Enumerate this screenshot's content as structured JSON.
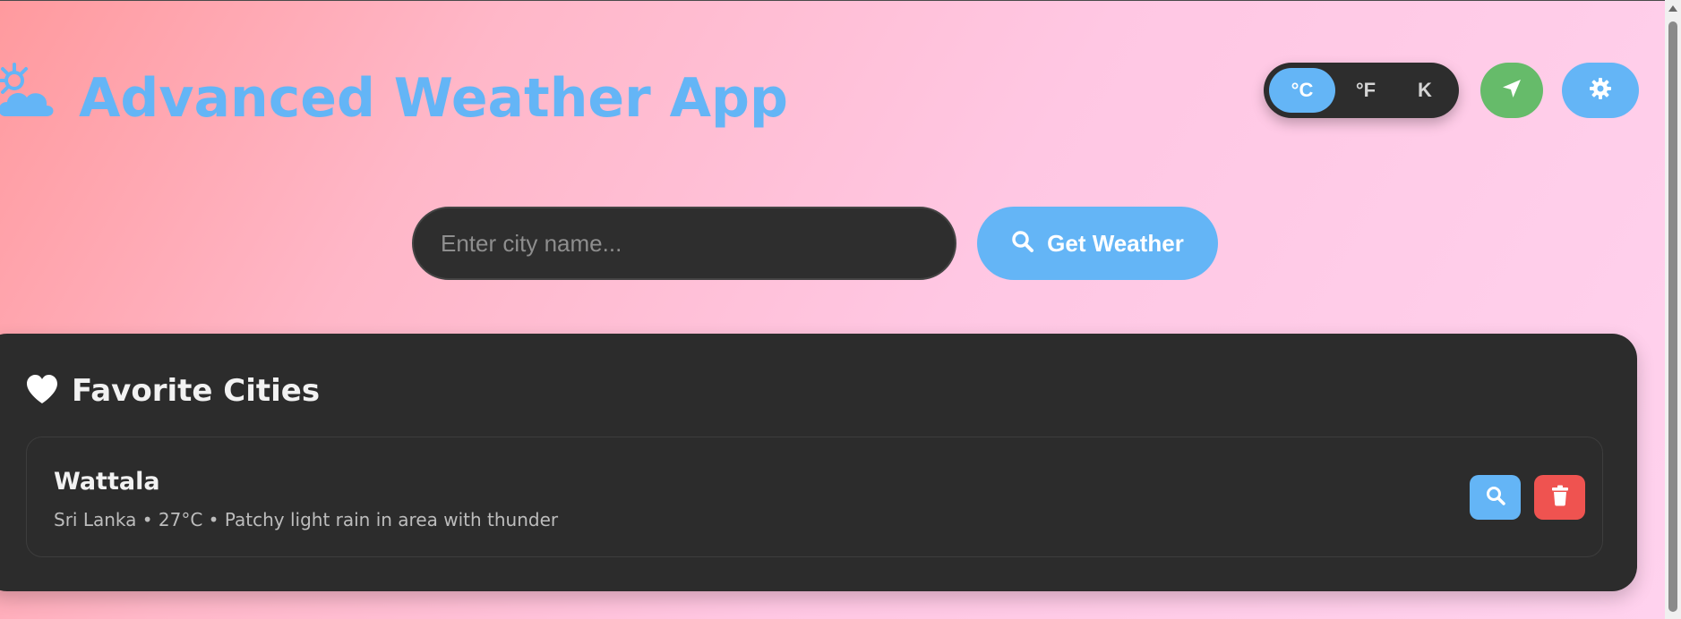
{
  "header": {
    "title": "Advanced Weather App",
    "logo_icon": "sun-behind-cloud-icon"
  },
  "units": {
    "options": [
      "°C",
      "°F",
      "K"
    ],
    "selected": "°C"
  },
  "actions": {
    "location_icon": "location-arrow-icon",
    "settings_icon": "gear-icon"
  },
  "search": {
    "placeholder": "Enter city name...",
    "value": "",
    "button_label": "Get Weather",
    "button_icon": "search-icon"
  },
  "favorites": {
    "heading": "Favorite Cities",
    "heading_icon": "heart-icon",
    "items": [
      {
        "name": "Wattala",
        "details": "Sri Lanka • 27°C • Patchy light rain in area with thunder",
        "search_icon": "search-icon",
        "delete_icon": "trash-icon"
      }
    ]
  },
  "colors": {
    "accent": "#64b5f6",
    "location": "#66bb6a",
    "delete": "#ef5350",
    "panel": "#2c2c2c"
  }
}
